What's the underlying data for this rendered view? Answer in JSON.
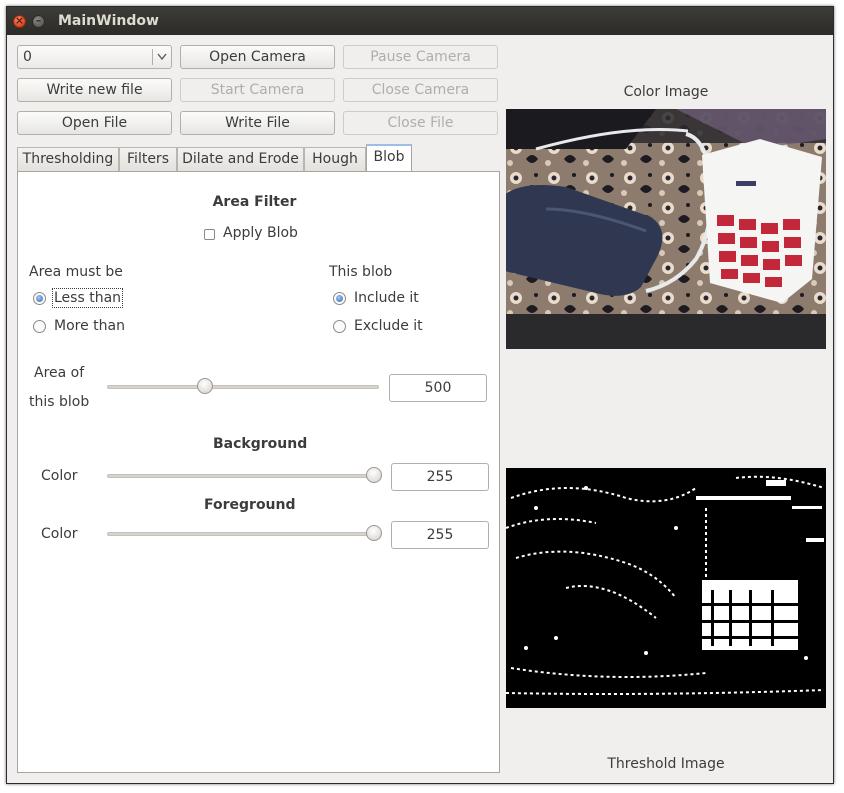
{
  "window": {
    "title": "MainWindow"
  },
  "toolbar": {
    "camera_index": "0",
    "open_camera": "Open Camera",
    "pause_camera": "Pause Camera",
    "write_new_file": "Write new file",
    "start_camera": "Start Camera",
    "close_camera": "Close Camera",
    "open_file": "Open File",
    "write_file": "Write File",
    "close_file": "Close File"
  },
  "tabs": [
    "Thresholding",
    "Filters",
    "Dilate and Erode",
    "Hough",
    "Blob"
  ],
  "active_tab": "Blob",
  "blob": {
    "section_title": "Area Filter",
    "apply_blob_label": "Apply Blob",
    "apply_blob_checked": false,
    "area_must_be_label": "Area must be",
    "less_than": "Less than",
    "more_than": "More than",
    "area_mode": "Less than",
    "this_blob_label": "This blob",
    "include_it": "Include it",
    "exclude_it": "Exclude it",
    "blob_mode": "Include it",
    "area_label_line1": "Area of",
    "area_label_line2": "this blob",
    "area_value": "500",
    "area_slider_fraction": 0.35,
    "background_title": "Background",
    "background_color_label": "Color",
    "background_value": "255",
    "background_slider_fraction": 1.0,
    "foreground_title": "Foreground",
    "foreground_color_label": "Color",
    "foreground_value": "255",
    "foreground_slider_fraction": 1.0
  },
  "images": {
    "color_label": "Color Image",
    "threshold_label": "Threshold Image"
  }
}
